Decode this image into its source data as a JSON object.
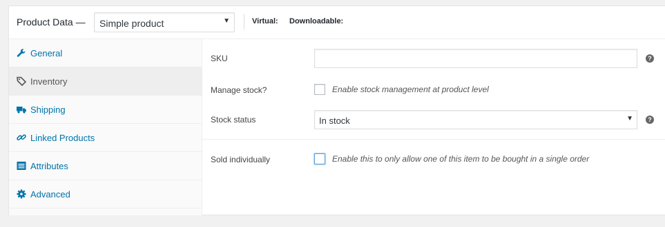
{
  "header": {
    "title": "Product Data —",
    "product_type": "Simple product",
    "virtual_label": "Virtual:",
    "downloadable_label": "Downloadable:"
  },
  "tabs": [
    {
      "label": "General",
      "icon": "wrench-icon",
      "active": false
    },
    {
      "label": "Inventory",
      "icon": "tag-icon",
      "active": true
    },
    {
      "label": "Shipping",
      "icon": "truck-icon",
      "active": false
    },
    {
      "label": "Linked Products",
      "icon": "link-icon",
      "active": false
    },
    {
      "label": "Attributes",
      "icon": "list-icon",
      "active": false
    },
    {
      "label": "Advanced",
      "icon": "gear-icon",
      "active": false
    }
  ],
  "inventory": {
    "sku_label": "SKU",
    "sku_value": "",
    "manage_stock_label": "Manage stock?",
    "manage_stock_desc": "Enable stock management at product level",
    "manage_stock_checked": false,
    "stock_status_label": "Stock status",
    "stock_status_value": "In stock",
    "sold_individually_label": "Sold individually",
    "sold_individually_desc": "Enable this to only allow one of this item to be bought in a single order",
    "sold_individually_checked": false
  },
  "help_glyph": "?",
  "colors": {
    "link": "#0073aa",
    "active_tab_bg": "#eeeeee",
    "focus_border": "#5b9dd9"
  }
}
